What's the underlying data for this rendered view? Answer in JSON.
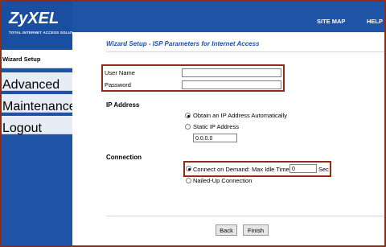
{
  "brand": {
    "name": "ZyXEL",
    "tagline": "TOTAL INTERNET ACCESS SOLUTION"
  },
  "topbar": {
    "site_map": "SITE MAP",
    "help": "HELP"
  },
  "sidebar": {
    "items": [
      {
        "label": "Wizard Setup"
      },
      {
        "label": "Advanced Setup"
      },
      {
        "label": "Maintenance"
      },
      {
        "label": "Logout"
      }
    ]
  },
  "page": {
    "title": "Wizard Setup - ISP Parameters for Internet Access"
  },
  "form": {
    "username_label": "User Name",
    "username_value": "",
    "password_label": "Password",
    "password_value": "",
    "ip_section": "IP Address",
    "ip_auto_label": "Obtain an IP Address Automatically",
    "ip_static_label": "Static IP Address",
    "static_ip_value": "0.0.0.0",
    "connection_section": "Connection",
    "connect_demand_label": "Connect on Demand: Max Idle Time",
    "idle_time_value": "0",
    "idle_unit": "Sec",
    "nailed_up_label": "Nailed-Up Connection"
  },
  "buttons": {
    "back": "Back",
    "finish": "Finish"
  },
  "colors": {
    "accent": "#1e53a6",
    "highlight": "#8e2c19"
  }
}
